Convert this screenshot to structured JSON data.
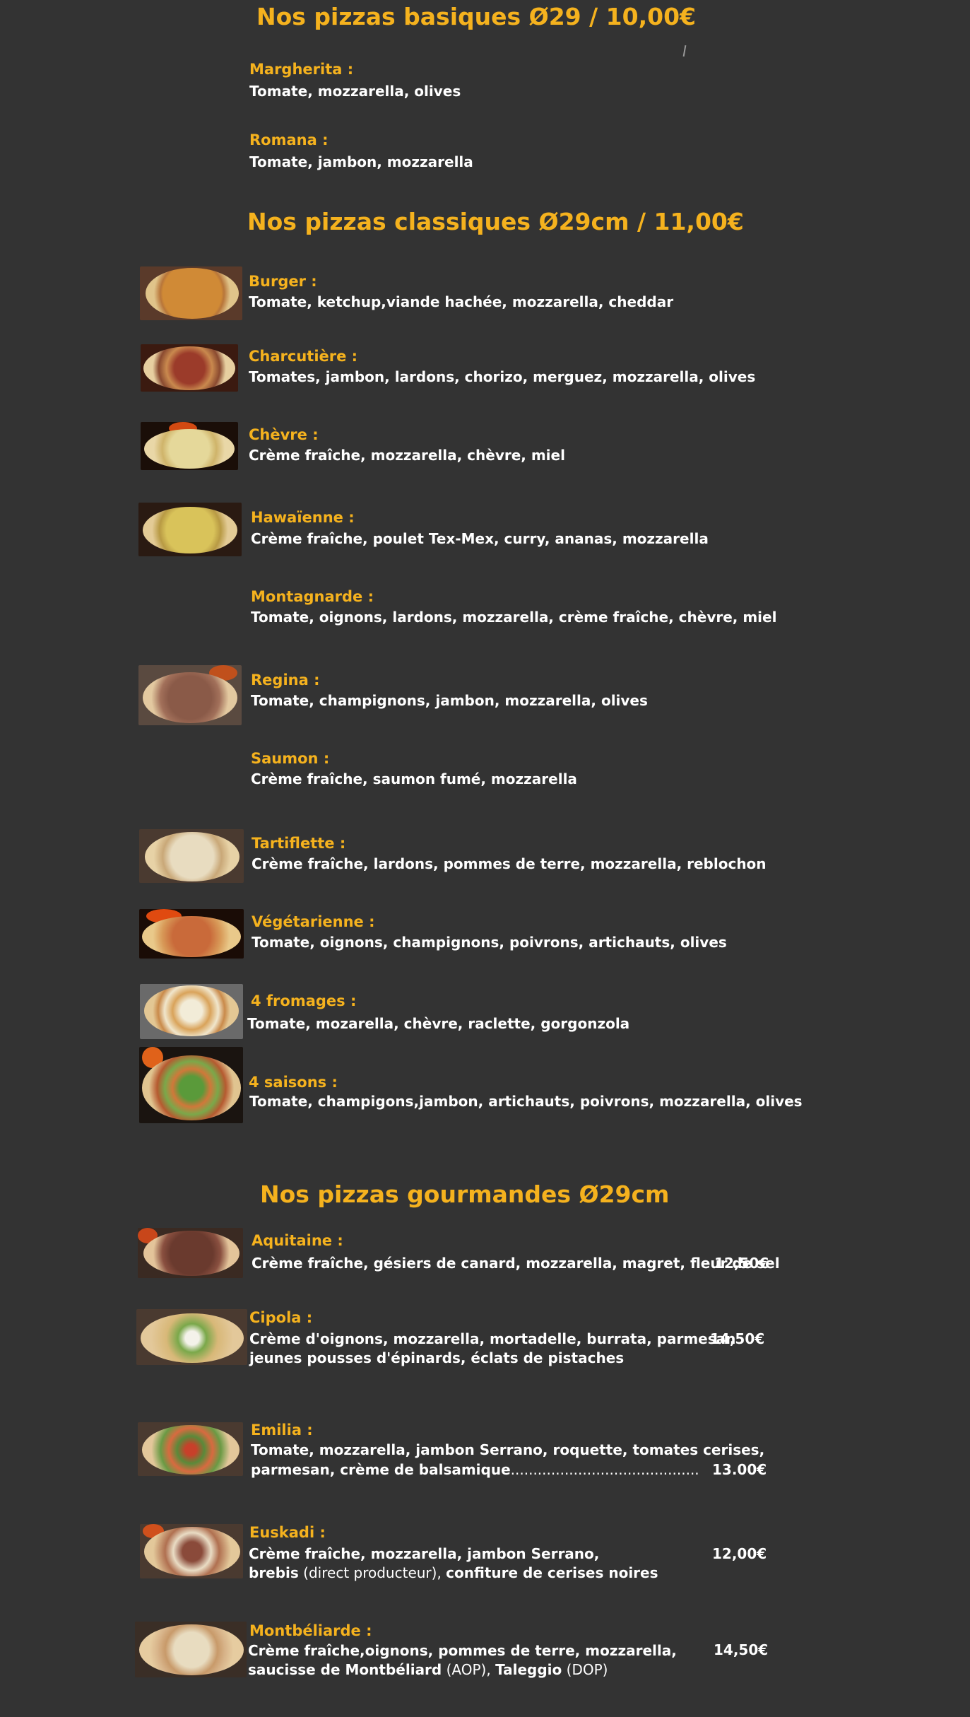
{
  "sections": {
    "basiques": {
      "title": "Nos pizzas basiques Ø29 / 10,00€",
      "items": [
        {
          "name": "Margherita :",
          "desc": "Tomate, mozzarella, olives"
        },
        {
          "name": "Romana :",
          "desc": "Tomate, jambon, mozzarella"
        }
      ]
    },
    "classiques": {
      "title": "Nos pizzas classiques Ø29cm / 11,00€",
      "items": [
        {
          "name": "Burger :",
          "desc": "Tomate, ketchup,viande hachée, mozzarella, cheddar"
        },
        {
          "name": "Charcutière :",
          "desc": "Tomates, jambon, lardons, chorizo, merguez, mozzarella, olives"
        },
        {
          "name": "Chèvre :",
          "desc": "Crème fraîche, mozzarella, chèvre, miel"
        },
        {
          "name": "Hawaïenne :",
          "desc": "Crème fraîche, poulet Tex-Mex, curry, ananas, mozzarella"
        },
        {
          "name": "Montagnarde :",
          "desc": "Tomate, oignons, lardons, mozzarella, crème fraîche, chèvre, miel"
        },
        {
          "name": "Regina :",
          "desc": "Tomate, champignons, jambon, mozzarella, olives"
        },
        {
          "name": "Saumon :",
          "desc": "Crème fraîche, saumon fumé, mozzarella"
        },
        {
          "name": "Tartiflette :",
          "desc": "Crème fraîche, lardons, pommes de terre, mozzarella, reblochon"
        },
        {
          "name": "Végétarienne :",
          "desc": "Tomate, oignons, champignons, poivrons, artichauts, olives"
        },
        {
          "name": "4 fromages :",
          "desc": "Tomate, mozarella, chèvre, raclette, gorgonzola"
        },
        {
          "name": "4 saisons :",
          "desc": "Tomate, champigons,jambon, artichauts, poivrons, mozzarella, olives"
        }
      ]
    },
    "gourmandes": {
      "title": "Nos pizzas gourmandes Ø29cm",
      "items": [
        {
          "name": "Aquitaine :",
          "desc": "Crème fraîche, gésiers de canard, mozzarella, magret, fleur de sel",
          "price": "12,50€"
        },
        {
          "name": "Cipola :",
          "desc": "Crème d'oignons, mozzarella, mortadelle, burrata, parmesan",
          "desc2": "jeunes pousses d'épinards, éclats de pistaches",
          "price": "14,50€"
        },
        {
          "name": "Emilia :",
          "desc": "Tomate, mozzarella, jambon Serrano, roquette, tomates cerises,",
          "desc2": "parmesan, crème de balsamique",
          "dots": "..........................................",
          "price": "13.00€"
        },
        {
          "name": "Euskadi :",
          "desc": "Crème fraîche, mozzarella, jambon Serrano,",
          "desc2_a": "brebis",
          "desc2_b": " (direct producteur), ",
          "desc2_c": "confiture de cerises noires",
          "price": "12,00€"
        },
        {
          "name": "Montbéliarde :",
          "desc": "Crème fraîche,oignons, pommes de terre, mozzarella,",
          "desc2_a": "saucisse de Montbéliard",
          "desc2_b": " (AOP), ",
          "desc2_c": "Taleggio",
          "desc2_d": " (DOP)",
          "price": "14,50€"
        }
      ]
    }
  },
  "colors": {
    "background": "#333333",
    "accent": "#f5b21e",
    "text": "#ffffff"
  }
}
